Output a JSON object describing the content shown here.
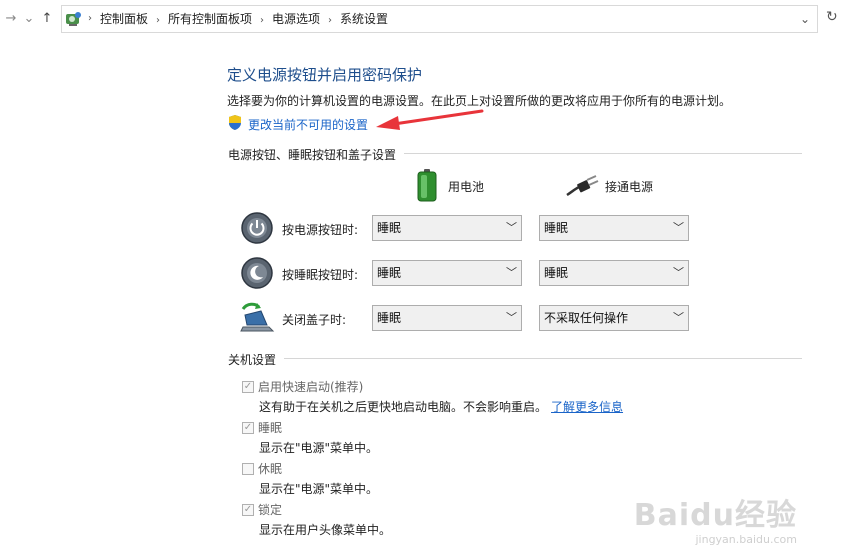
{
  "nav": {
    "forward": "→",
    "recent": "⌄",
    "up": "↑",
    "refresh": "↻",
    "dropdown": "⌄"
  },
  "breadcrumbs": [
    "控制面板",
    "所有控制面板项",
    "电源选项",
    "系统设置"
  ],
  "page": {
    "title": "定义电源按钮并启用密码保护",
    "description": "选择要为你的计算机设置的电源设置。在此页上对设置所做的更改将应用于你所有的电源计划。",
    "change_link": "更改当前不可用的设置"
  },
  "power_buttons": {
    "section_title": "电源按钮、睡眠按钮和盖子设置",
    "col_battery": "用电池",
    "col_plugged": "接通电源",
    "rows": [
      {
        "label": "按电源按钮时:",
        "battery": "睡眠",
        "plugged": "睡眠",
        "icon": "power-button-icon"
      },
      {
        "label": "按睡眠按钮时:",
        "battery": "睡眠",
        "plugged": "睡眠",
        "icon": "sleep-button-icon"
      },
      {
        "label": "关闭盖子时:",
        "battery": "睡眠",
        "plugged": "不采取任何操作",
        "icon": "laptop-lid-icon"
      }
    ]
  },
  "shutdown": {
    "section_title": "关机设置",
    "items": [
      {
        "label": "启用快速启动(推荐)",
        "checked": true,
        "desc": "这有助于在关机之后更快地启动电脑。不会影响重启。",
        "link": "了解更多信息"
      },
      {
        "label": "睡眠",
        "checked": true,
        "desc": "显示在\"电源\"菜单中。"
      },
      {
        "label": "休眠",
        "checked": false,
        "desc": "显示在\"电源\"菜单中。"
      },
      {
        "label": "锁定",
        "checked": true,
        "desc": "显示在用户头像菜单中。"
      }
    ]
  },
  "watermark": {
    "brand": "Baidu经验",
    "url": "jingyan.baidu.com"
  },
  "colors": {
    "title": "#1e4e8c",
    "link": "#1a64c8",
    "arrow": "#e8343a"
  }
}
